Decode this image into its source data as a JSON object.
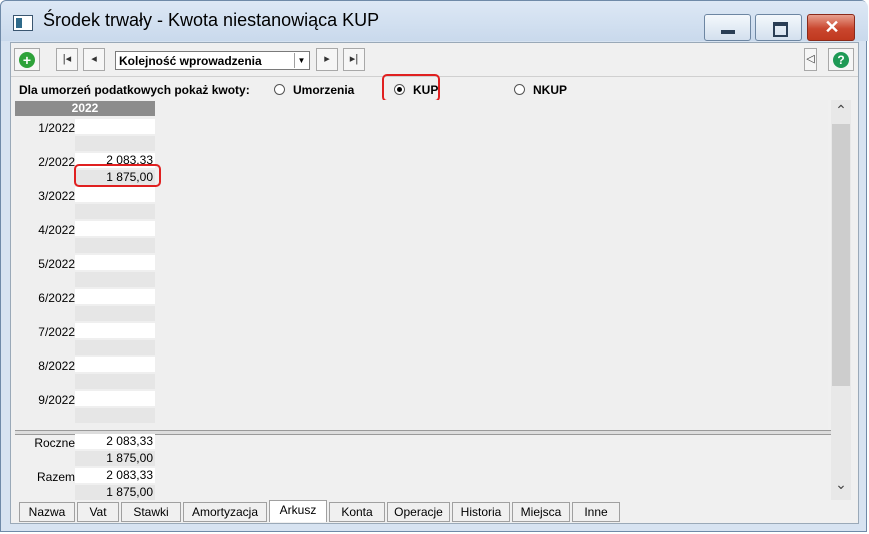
{
  "window": {
    "title": "Środek trwały - Kwota niestanowiąca KUP"
  },
  "toolbar": {
    "order_value": "Kolejność wprowadzenia"
  },
  "radio_group": {
    "label": "Dla umorzeń podatkowych pokaż kwoty:",
    "options": [
      {
        "label": "Umorzenia",
        "selected": false
      },
      {
        "label": "KUP",
        "selected": true
      },
      {
        "label": "NKUP",
        "selected": false
      }
    ]
  },
  "grid": {
    "year": "2022",
    "rows": [
      {
        "month": "1/2022",
        "v1": "",
        "v2": ""
      },
      {
        "month": "2/2022",
        "v1": "2 083,33",
        "v2": "1 875,00"
      },
      {
        "month": "3/2022",
        "v1": "",
        "v2": ""
      },
      {
        "month": "4/2022",
        "v1": "",
        "v2": ""
      },
      {
        "month": "5/2022",
        "v1": "",
        "v2": ""
      },
      {
        "month": "6/2022",
        "v1": "",
        "v2": ""
      },
      {
        "month": "7/2022",
        "v1": "",
        "v2": ""
      },
      {
        "month": "8/2022",
        "v1": "",
        "v2": ""
      },
      {
        "month": "9/2022",
        "v1": "",
        "v2": ""
      }
    ]
  },
  "summary": [
    {
      "label": "Roczne",
      "v1": "2 083,33",
      "v2": "1 875,00"
    },
    {
      "label": "Razem",
      "v1": "2 083,33",
      "v2": "1 875,00"
    }
  ],
  "tabs": [
    {
      "label": "Nazwa",
      "active": false
    },
    {
      "label": "Vat",
      "active": false
    },
    {
      "label": "Stawki",
      "active": false
    },
    {
      "label": "Amortyzacja",
      "active": false
    },
    {
      "label": "Arkusz",
      "active": true
    },
    {
      "label": "Konta",
      "active": false
    },
    {
      "label": "Operacje",
      "active": false
    },
    {
      "label": "Historia",
      "active": false
    },
    {
      "label": "Miejsca",
      "active": false
    },
    {
      "label": "Inne",
      "active": false
    }
  ],
  "colors": {
    "highlight": "#e02020",
    "add_icon": "#2ea23a",
    "help_icon": "#1f9a56",
    "close_button": "#c9462e"
  }
}
